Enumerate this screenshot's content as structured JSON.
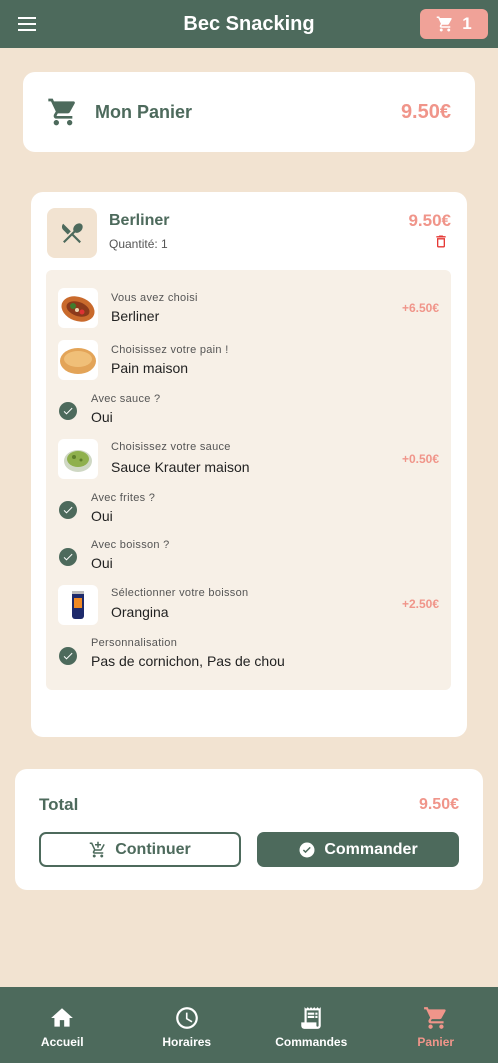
{
  "app": {
    "title": "Bec Snacking",
    "cart_count": "1"
  },
  "header": {
    "title": "Mon Panier",
    "price": "9.50€"
  },
  "item": {
    "name": "Berliner",
    "quantity": "Quantité: 1",
    "price": "9.50€",
    "options": [
      {
        "label": "Vous avez choisi",
        "value": "Berliner",
        "extra": "+6.50€",
        "kind": "image",
        "image": "kebab"
      },
      {
        "label": "Choisissez votre pain !",
        "value": "Pain maison",
        "extra": "",
        "kind": "image",
        "image": "bread"
      },
      {
        "label": "Avec sauce ?",
        "value": "Oui",
        "extra": "",
        "kind": "check"
      },
      {
        "label": "Choisissez votre sauce",
        "value": "Sauce Krauter maison",
        "extra": "+0.50€",
        "kind": "image",
        "image": "sauce"
      },
      {
        "label": "Avec frites ?",
        "value": "Oui",
        "extra": "",
        "kind": "check"
      },
      {
        "label": "Avec boisson ?",
        "value": "Oui",
        "extra": "",
        "kind": "check"
      },
      {
        "label": "Sélectionner votre boisson",
        "value": "Orangina",
        "extra": "+2.50€",
        "kind": "image",
        "image": "can"
      },
      {
        "label": "Personnalisation",
        "value": "Pas de cornichon, Pas de chou",
        "extra": "",
        "kind": "check"
      }
    ]
  },
  "total": {
    "label": "Total",
    "value": "9.50€",
    "continue_label": "Continuer",
    "order_label": "Commander"
  },
  "nav": [
    {
      "label": "Accueil",
      "icon": "home-icon",
      "active": false
    },
    {
      "label": "Horaires",
      "icon": "clock-icon",
      "active": false
    },
    {
      "label": "Commandes",
      "icon": "receipt-icon",
      "active": false
    },
    {
      "label": "Panier",
      "icon": "cart-icon",
      "active": true
    }
  ],
  "colors": {
    "primary": "#4d6a5c",
    "accent": "#f0958a",
    "background": "#f2e3d1"
  }
}
